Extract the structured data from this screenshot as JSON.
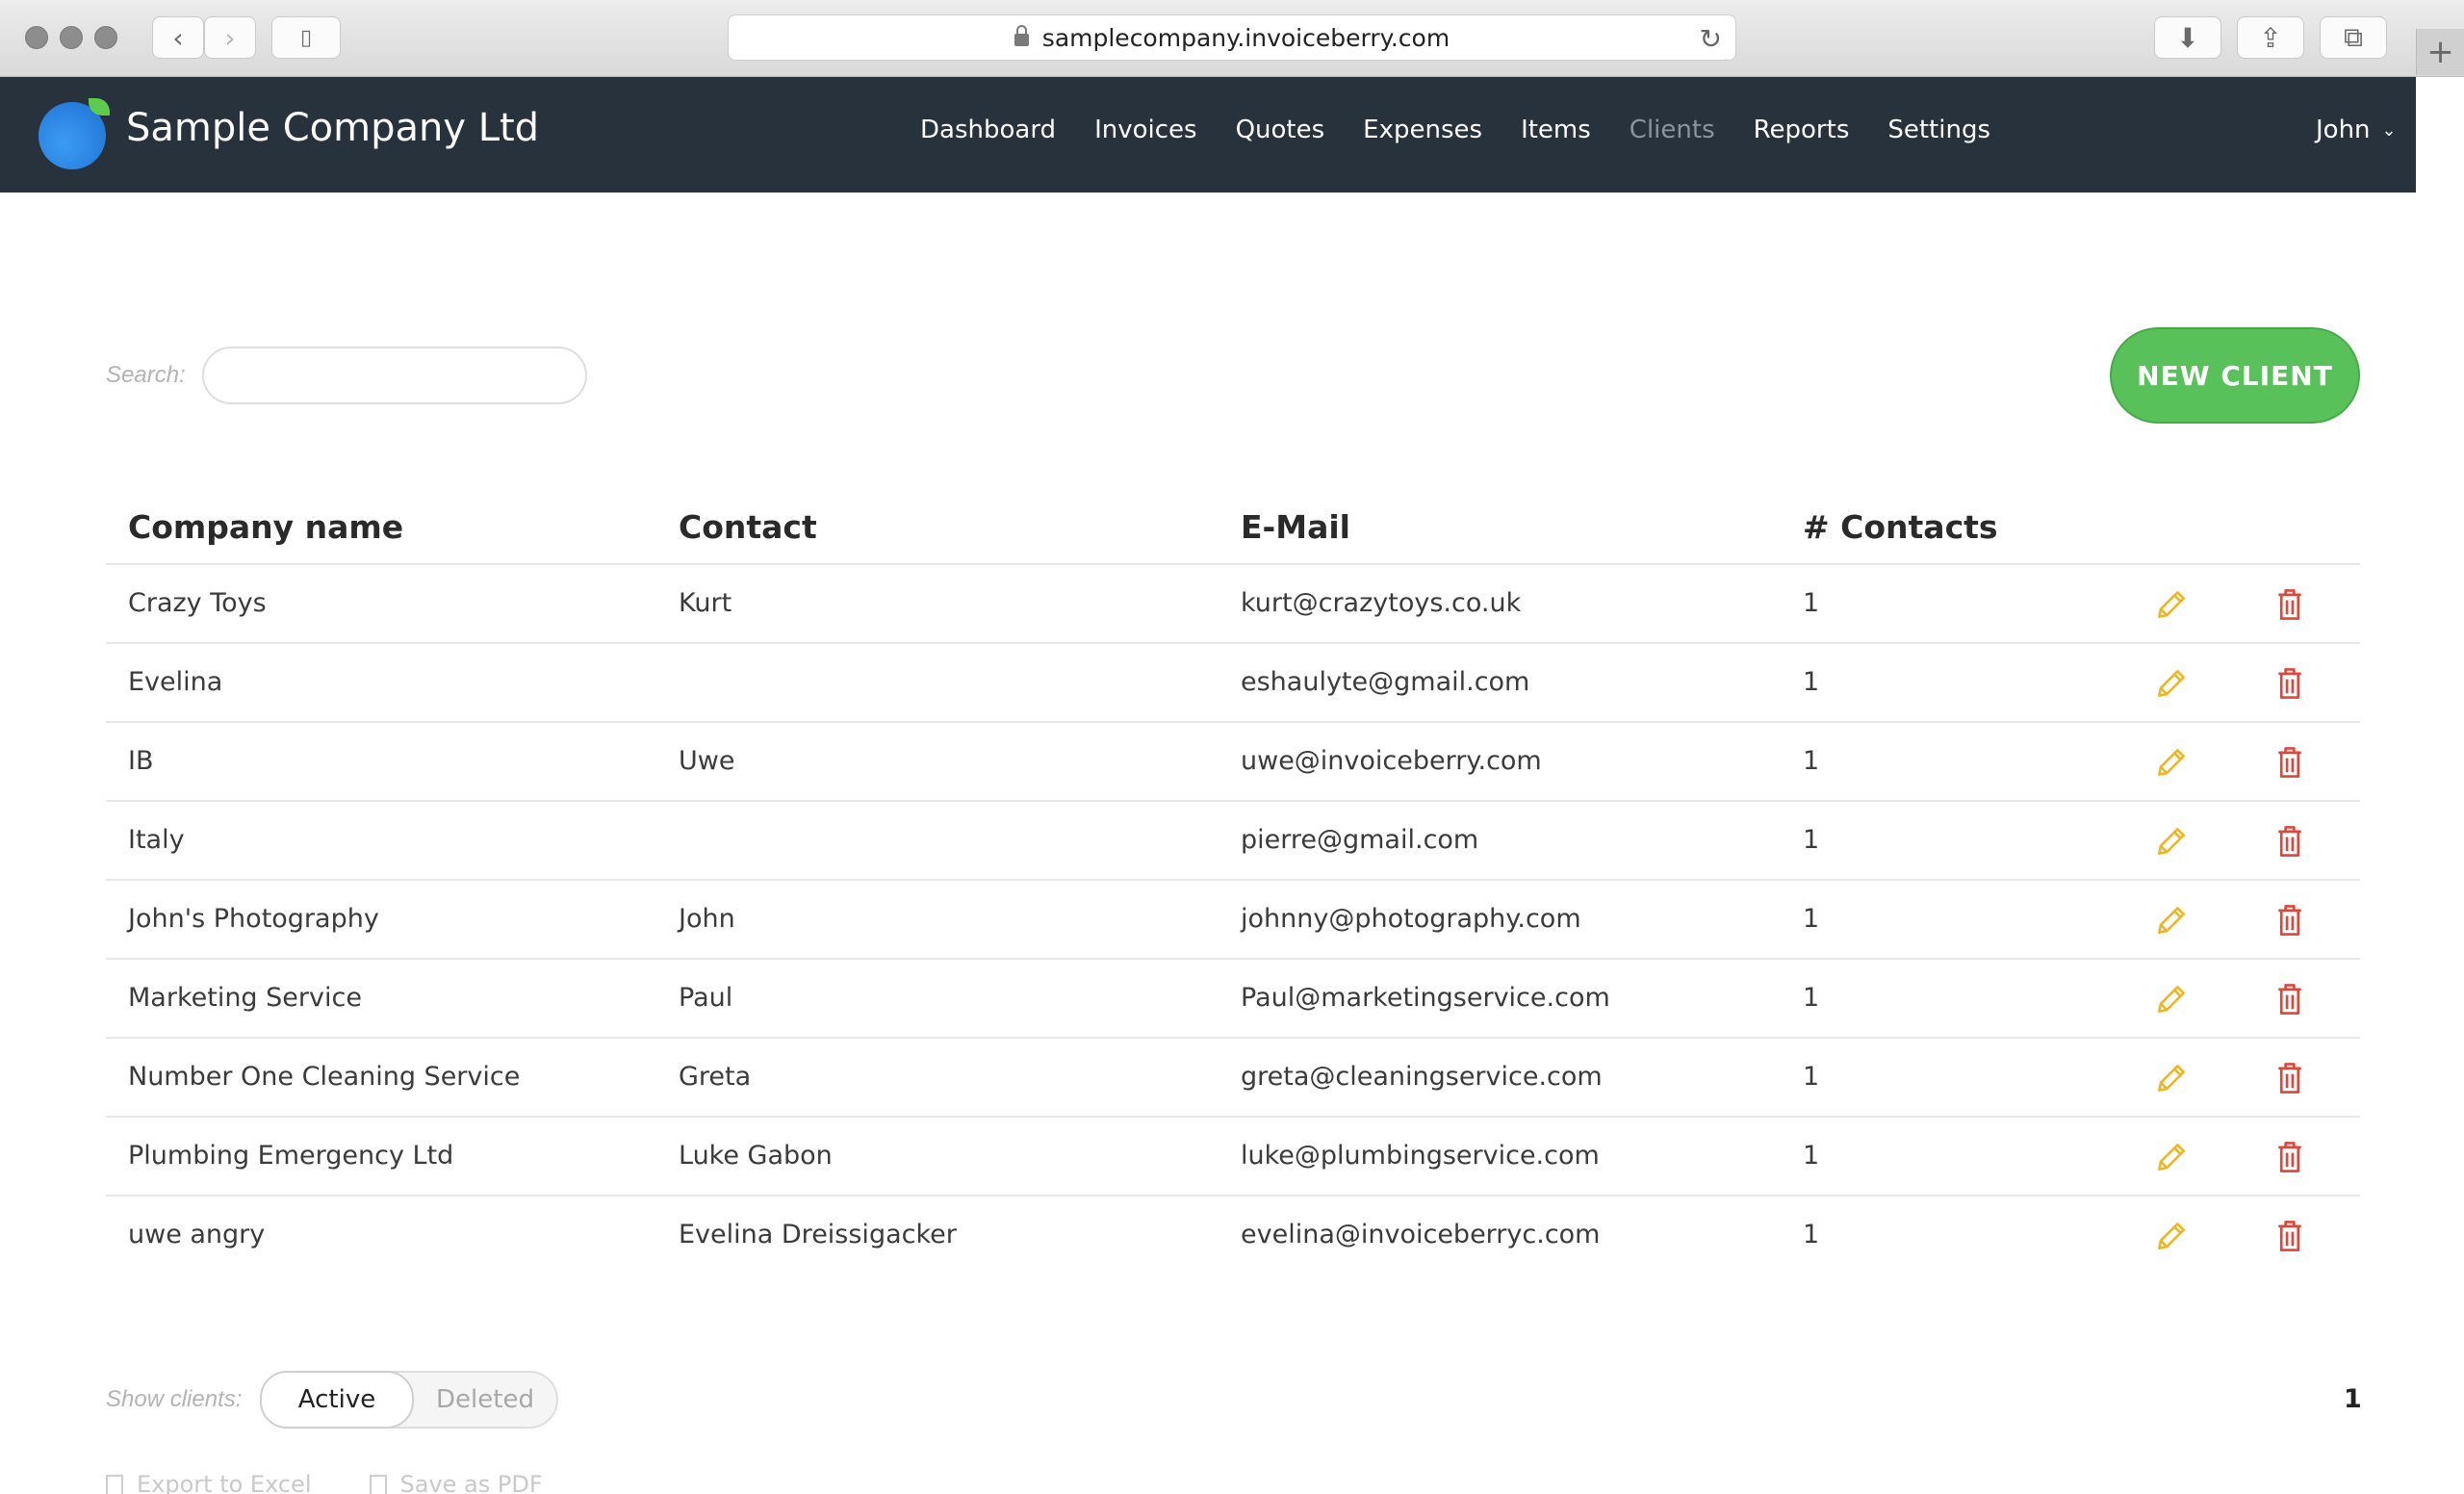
{
  "browser": {
    "url": "samplecompany.invoiceberry.com"
  },
  "app": {
    "brand": "Sample Company Ltd",
    "nav": [
      "Dashboard",
      "Invoices",
      "Quotes",
      "Expenses",
      "Items",
      "Clients",
      "Reports",
      "Settings"
    ],
    "active_nav": "Clients",
    "user": "John",
    "accent_color": "#58c15a",
    "navbar_color": "#27323c",
    "edit_icon_color": "#f0b321",
    "delete_icon_color": "#e0453a"
  },
  "search": {
    "label": "Search:",
    "value": ""
  },
  "new_client_label": "NEW CLIENT",
  "table": {
    "headers": {
      "company": "Company name",
      "contact": "Contact",
      "email": "E-Mail",
      "contacts": "# Contacts"
    },
    "rows": [
      {
        "company": "Crazy Toys",
        "contact": "Kurt",
        "email": "kurt@crazytoys.co.uk",
        "contacts": "1"
      },
      {
        "company": "Evelina",
        "contact": "",
        "email": "eshaulyte@gmail.com",
        "contacts": "1"
      },
      {
        "company": "IB",
        "contact": "Uwe",
        "email": "uwe@invoiceberry.com",
        "contacts": "1"
      },
      {
        "company": "Italy",
        "contact": "",
        "email": "pierre@gmail.com",
        "contacts": "1"
      },
      {
        "company": "John's Photography",
        "contact": "John",
        "email": "johnny@photography.com",
        "contacts": "1"
      },
      {
        "company": "Marketing Service",
        "contact": "Paul",
        "email": "Paul@marketingservice.com",
        "contacts": "1"
      },
      {
        "company": "Number One Cleaning Service",
        "contact": "Greta",
        "email": "greta@cleaningservice.com",
        "contacts": "1"
      },
      {
        "company": "Plumbing Emergency Ltd",
        "contact": "Luke Gabon",
        "email": "luke@plumbingservice.com",
        "contacts": "1"
      },
      {
        "company": "uwe angry",
        "contact": "Evelina Dreissigacker",
        "email": "evelina@invoiceberryc.com",
        "contacts": "1"
      }
    ]
  },
  "footer": {
    "show_label": "Show clients:",
    "active_label": "Active",
    "deleted_label": "Deleted",
    "page": "1",
    "export_excel": "Export to Excel",
    "save_pdf": "Save as PDF"
  }
}
